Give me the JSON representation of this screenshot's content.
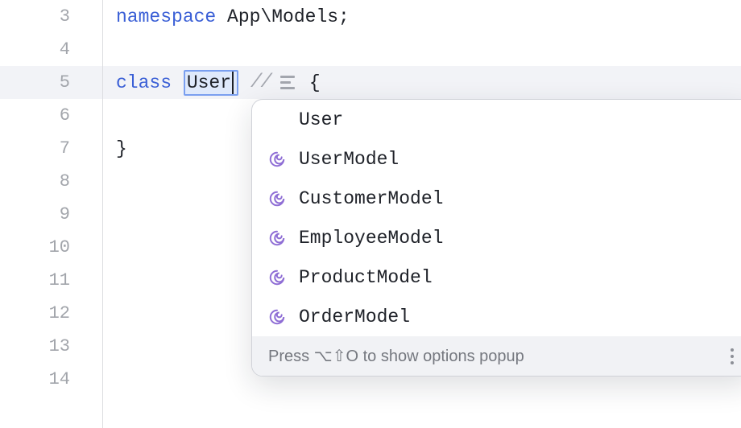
{
  "editor": {
    "lines": [
      {
        "num": "3"
      },
      {
        "num": "4"
      },
      {
        "num": "5",
        "active": true
      },
      {
        "num": "6"
      },
      {
        "num": "7"
      },
      {
        "num": "8"
      },
      {
        "num": "9"
      },
      {
        "num": "10"
      },
      {
        "num": "11"
      },
      {
        "num": "12"
      },
      {
        "num": "13"
      },
      {
        "num": "14"
      }
    ],
    "code": {
      "ns_keyword": "namespace",
      "ns_value": " App\\Models;",
      "class_keyword": "class",
      "class_name": "User",
      "brace_open": "{",
      "brace_close": "}"
    }
  },
  "popup": {
    "items": [
      {
        "label": "User",
        "icon": false
      },
      {
        "label": "UserModel",
        "icon": true
      },
      {
        "label": "CustomerModel",
        "icon": true
      },
      {
        "label": "EmployeeModel",
        "icon": true
      },
      {
        "label": "ProductModel",
        "icon": true
      },
      {
        "label": "OrderModel",
        "icon": true
      }
    ],
    "footer": "Press ⌥⇧O to show options popup"
  }
}
